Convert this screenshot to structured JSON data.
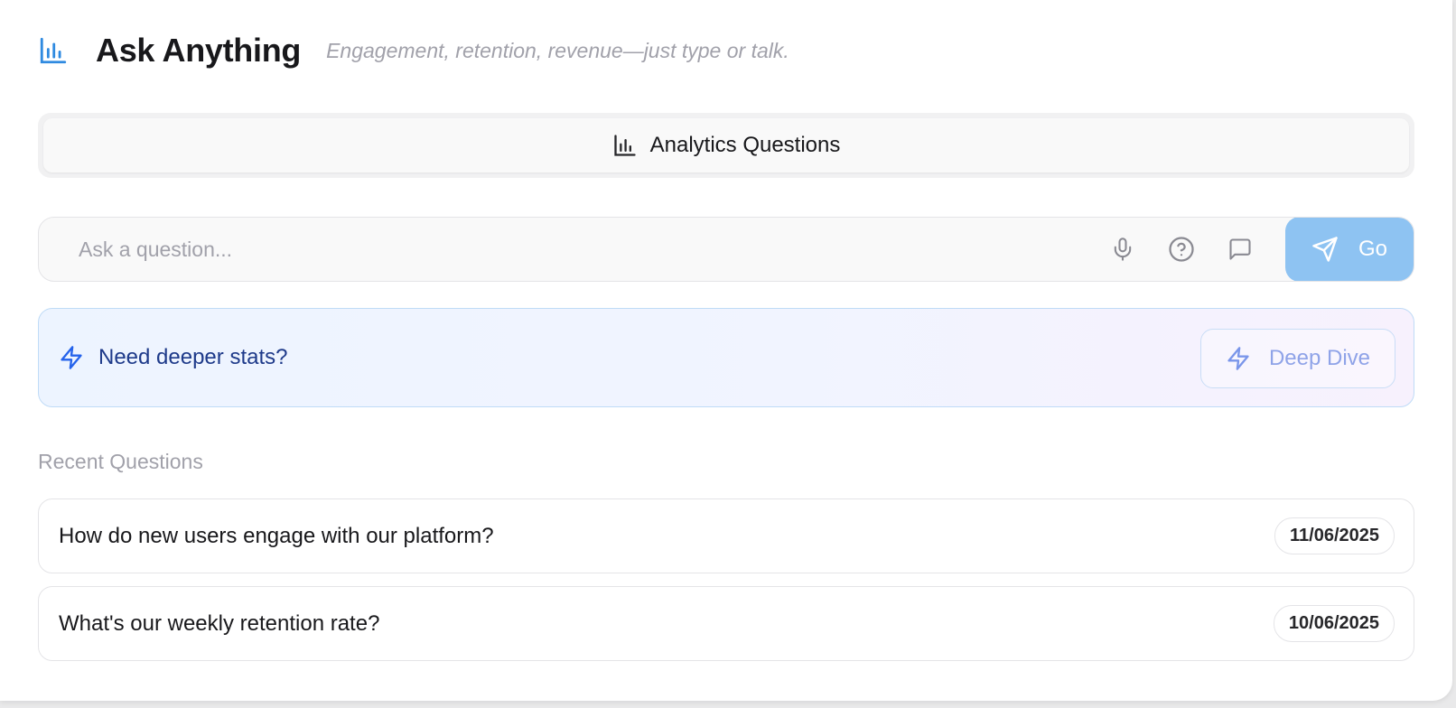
{
  "header": {
    "title": "Ask Anything",
    "subtitle": "Engagement, retention, revenue—just type or talk.",
    "logo_icon": "bar-chart-icon",
    "accent_color": "#2f8ae0"
  },
  "tabs": [
    {
      "label": "Analytics Questions",
      "icon": "bar-chart-icon",
      "active": true
    }
  ],
  "search": {
    "placeholder": "Ask a question...",
    "value": "",
    "icons": [
      "microphone-icon",
      "help-circle-icon",
      "message-square-icon"
    ],
    "submit_label": "Go",
    "submit_icon": "send-icon",
    "submit_color": "#8ec3f2"
  },
  "promo": {
    "text": "Need deeper stats?",
    "icon": "lightning-icon",
    "button_label": "Deep Dive",
    "button_icon": "lightning-icon"
  },
  "recent": {
    "heading": "Recent Questions",
    "items": [
      {
        "question": "How do new users engage with our platform?",
        "date": "11/06/2025"
      },
      {
        "question": "What's our weekly retention rate?",
        "date": "10/06/2025"
      }
    ]
  }
}
